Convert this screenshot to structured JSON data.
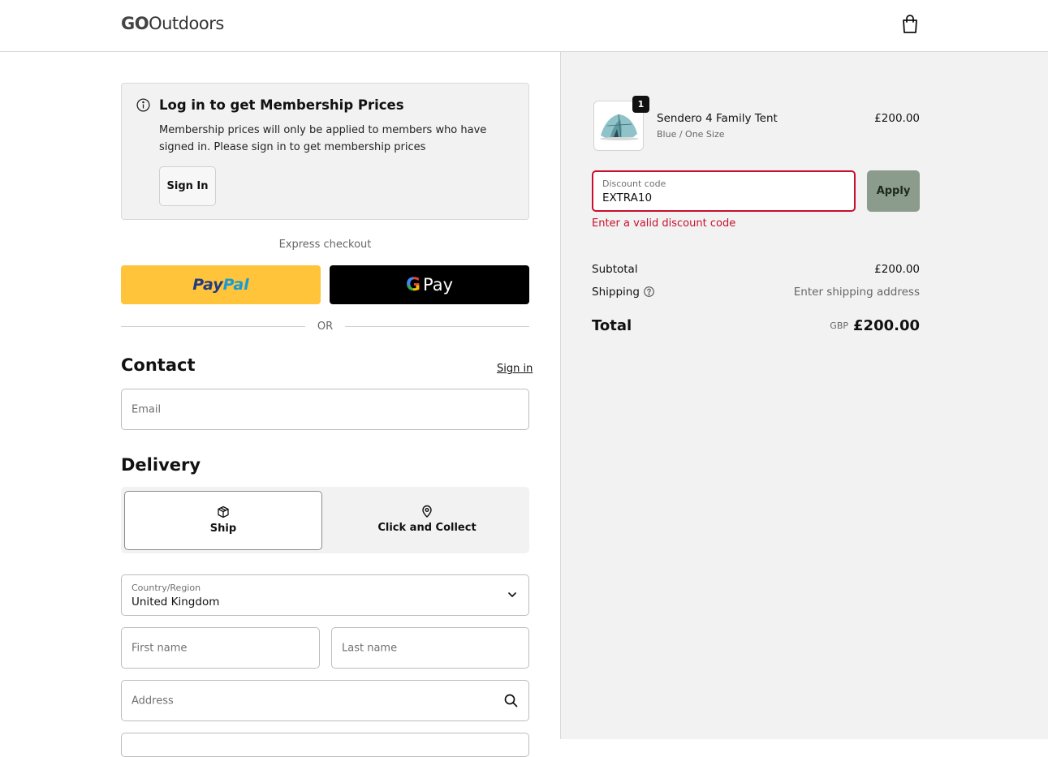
{
  "header": {
    "brand_bold": "GO",
    "brand_rest": "Outdoors",
    "cart_icon": "shopping-bag-icon"
  },
  "membership": {
    "title": "Log in to get Membership Prices",
    "text": "Membership prices will only be applied to members who have signed in. Please sign in to get membership prices",
    "button": "Sign In"
  },
  "express": {
    "label": "Express checkout",
    "paypal_part1": "Pay",
    "paypal_part2": "Pal",
    "gpay_g": "G",
    "gpay_pay": "Pay",
    "or": "OR"
  },
  "contact": {
    "heading": "Contact",
    "signin_link": "Sign in",
    "email_placeholder": "Email"
  },
  "delivery": {
    "heading": "Delivery",
    "options": [
      {
        "label": "Ship",
        "icon": "box-icon",
        "selected": true
      },
      {
        "label": "Click and Collect",
        "icon": "map-pin-icon",
        "selected": false
      }
    ],
    "country_label": "Country/Region",
    "country_value": "United Kingdom",
    "first_name_placeholder": "First name",
    "last_name_placeholder": "Last name",
    "address_placeholder": "Address"
  },
  "summary": {
    "item": {
      "quantity": "1",
      "name": "Sendero 4 Family Tent",
      "variant": "Blue / One Size",
      "price": "£200.00"
    },
    "discount": {
      "label": "Discount code",
      "value": "EXTRA10",
      "apply": "Apply",
      "error": "Enter a valid discount code"
    },
    "subtotal_label": "Subtotal",
    "subtotal_value": "£200.00",
    "shipping_label": "Shipping",
    "shipping_value": "Enter shipping address",
    "total_label": "Total",
    "total_currency": "GBP",
    "total_value": "£200.00"
  },
  "colors": {
    "error": "#c8102e",
    "paypal_yellow": "#ffc439",
    "apply_green": "#8c9c8c",
    "summary_bg": "#f2f2f2"
  }
}
